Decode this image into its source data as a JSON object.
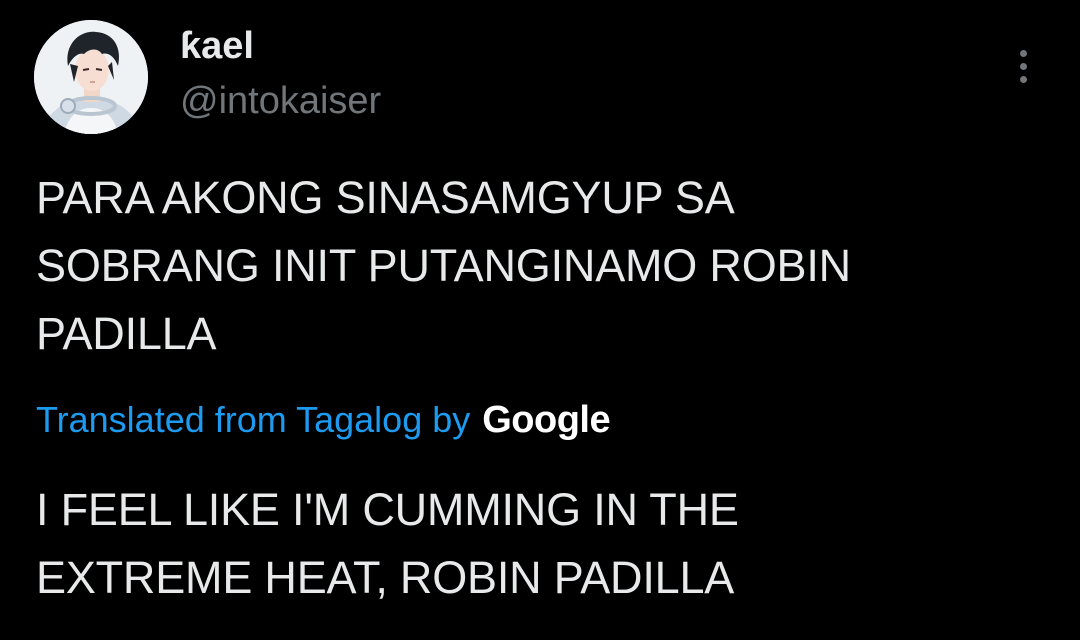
{
  "user": {
    "display_name": "ƙael",
    "handle": "@intokaiser",
    "avatar_icon": "profile-avatar"
  },
  "menu": {
    "icon": "more-vertical-icon"
  },
  "tweet": {
    "text_lines": [
      "PARA AKONG SINASAMGYUP SA",
      "SOBRANG INIT PUTANGINAMO ROBIN",
      "PADILLA"
    ]
  },
  "translation": {
    "label": "Translated from Tagalog by",
    "provider": "Google",
    "text_lines": [
      "I FEEL LIKE I'M CUMMING IN THE",
      "EXTREME HEAT, ROBIN PADILLA"
    ]
  },
  "colors": {
    "background": "#000000",
    "primary_text": "#e7e9ea",
    "secondary_text": "#71767b",
    "link": "#1d9bf0"
  }
}
